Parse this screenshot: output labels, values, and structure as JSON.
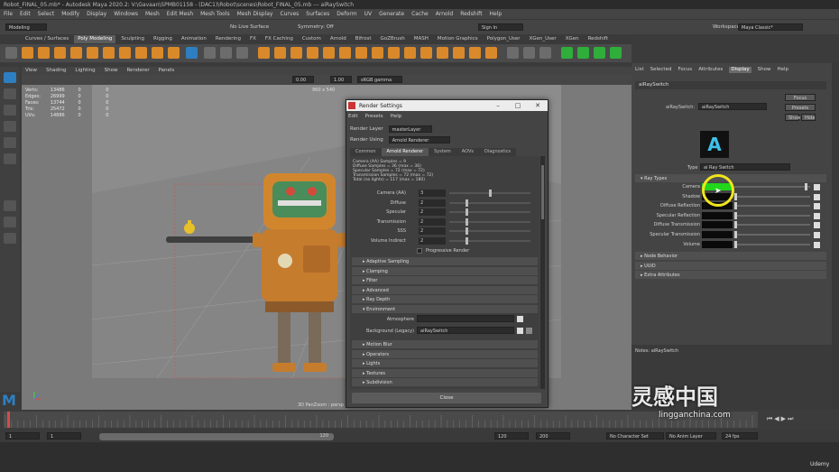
{
  "window": {
    "title": "Robot_FINAL_05.mb* - Autodesk Maya 2020.2: V:\\Gavaan\\SPMB01158 - (DAC1)\\Robot\\scenes\\Robot_FINAL_05.mb --- aiRaySwitch"
  },
  "menubar": [
    "File",
    "Edit",
    "Select",
    "Modify",
    "Display",
    "Windows",
    "Mesh",
    "Edit Mesh",
    "Mesh Tools",
    "Mesh Display",
    "Curves",
    "Surfaces",
    "Deform",
    "UV",
    "Generate",
    "Cache",
    "Arnold",
    "Redshift",
    "Help"
  ],
  "statusline": {
    "mode": "Modeling",
    "live_surface": "No Live Surface",
    "symmetry": "Symmetry: Off",
    "sign_in": "Sign In",
    "workspace_label": "Workspace:",
    "workspace": "Maya Classic*"
  },
  "shelf_tabs": [
    {
      "label": "Curves / Surfaces",
      "active": false
    },
    {
      "label": "Poly Modeling",
      "active": true
    },
    {
      "label": "Sculpting",
      "active": false
    },
    {
      "label": "Rigging",
      "active": false
    },
    {
      "label": "Animation",
      "active": false
    },
    {
      "label": "Rendering",
      "active": false
    },
    {
      "label": "FX",
      "active": false
    },
    {
      "label": "FX Caching",
      "active": false
    },
    {
      "label": "Custom",
      "active": false
    },
    {
      "label": "Arnold",
      "active": false
    },
    {
      "label": "Bifrost",
      "active": false
    },
    {
      "label": "GoZBrush",
      "active": false
    },
    {
      "label": "MASH",
      "active": false
    },
    {
      "label": "Motion Graphics",
      "active": false
    },
    {
      "label": "Polygon_User",
      "active": false
    },
    {
      "label": "XGen_User",
      "active": false
    },
    {
      "label": "XGen",
      "active": false
    },
    {
      "label": "Redshift",
      "active": false
    }
  ],
  "viewport": {
    "menu": [
      "View",
      "Shading",
      "Lighting",
      "Show",
      "Renderer",
      "Panels"
    ],
    "hud": [
      {
        "name": "Verts:",
        "a": "13486",
        "b": "0",
        "c": "0"
      },
      {
        "name": "Edges:",
        "a": "26999",
        "b": "0",
        "c": "0"
      },
      {
        "name": "Faces:",
        "a": "13744",
        "b": "0",
        "c": "0"
      },
      {
        "name": "Tris:",
        "a": "25472",
        "b": "0",
        "c": "0"
      },
      {
        "name": "UVs:",
        "a": "14886",
        "b": "0",
        "c": "0"
      }
    ],
    "resolution": "960 x 540",
    "camera": "3D PanZoom : persp",
    "exposure": "0.00",
    "gamma": "1.00",
    "colorspace": "sRGB gamma"
  },
  "render_settings": {
    "title": "Render Settings",
    "menu": [
      "Edit",
      "Presets",
      "Help"
    ],
    "render_layer_label": "Render Layer",
    "render_layer": "masterLayer",
    "render_using_label": "Render Using",
    "render_using": "Arnold Renderer",
    "tabs": [
      {
        "label": "Common",
        "active": false
      },
      {
        "label": "Arnold Renderer",
        "active": true
      },
      {
        "label": "System",
        "active": false
      },
      {
        "label": "AOVs",
        "active": false
      },
      {
        "label": "Diagnostics",
        "active": false
      }
    ],
    "stats": [
      "Camera (AA) Samples = 9",
      "Diffuse Samples = 36 (max = 36)",
      "Specular Samples = 72 (max = 72)",
      "Transmission Samples = 72 (max = 72)",
      "Total (no lights) = 117 (max = 180)"
    ],
    "samples": [
      {
        "label": "Camera (AA)",
        "value": "3",
        "level": 0.5
      },
      {
        "label": "Diffuse",
        "value": "2",
        "level": 0.2
      },
      {
        "label": "Specular",
        "value": "2",
        "level": 0.2
      },
      {
        "label": "Transmission",
        "value": "2",
        "level": 0.2
      },
      {
        "label": "SSS",
        "value": "2",
        "level": 0.2
      },
      {
        "label": "Volume Indirect",
        "value": "2",
        "level": 0.2
      }
    ],
    "progressive": "Progressive Render",
    "sections": [
      "Adaptive Sampling",
      "Clamping",
      "Filter",
      "Advanced",
      "Ray Depth"
    ],
    "environment": {
      "label": "Environment",
      "atmosphere_label": "Atmosphere",
      "background_label": "Background (Legacy)",
      "background": "aiRaySwitch"
    },
    "sections_after": [
      "Motion Blur",
      "Operators",
      "Lights",
      "Textures",
      "Subdivision"
    ],
    "close": "Close"
  },
  "attribute_editor": {
    "menu": [
      {
        "label": "List",
        "active": false
      },
      {
        "label": "Selected",
        "active": false
      },
      {
        "label": "Focus",
        "active": false
      },
      {
        "label": "Attributes",
        "active": false
      },
      {
        "label": "Display",
        "active": true
      },
      {
        "label": "Show",
        "active": false
      },
      {
        "label": "Help",
        "active": false
      }
    ],
    "tab": "aiRaySwitch",
    "node_label": "aiRaySwitch:",
    "node_value": "aiRaySwitch",
    "buttons": {
      "focus": "Focus",
      "presets": "Presets",
      "show": "Show",
      "hide": "Hide"
    },
    "type_label": "Type",
    "type_value": "ai Ray Switch",
    "ray_types_label": "Ray Types",
    "ray_types": [
      {
        "label": "Camera",
        "color": "#22d61c"
      },
      {
        "label": "Shadow",
        "color": "#0a0a0a"
      },
      {
        "label": "Diffuse Reflection",
        "color": "#0a0a0a"
      },
      {
        "label": "Specular Reflection",
        "color": "#0a0a0a"
      },
      {
        "label": "Diffuse Transmission",
        "color": "#0a0a0a"
      },
      {
        "label": "Specular Transmission",
        "color": "#0a0a0a"
      },
      {
        "label": "Volume",
        "color": "#0a0a0a"
      }
    ],
    "collapsed": [
      "Node Behavior",
      "UUID",
      "Extra Attributes"
    ],
    "notes": "Notes:  aiRaySwitch"
  },
  "timeline": {
    "start": "1",
    "start2": "1",
    "current": "120",
    "end": "120",
    "end2": "200",
    "character_set": "No Character Set",
    "anim_layer": "No Anim Layer",
    "fps": "24 fps"
  },
  "watermark": "灵感中国",
  "watermark_url": "lingganchina.com",
  "udemy": "Udemy",
  "colors": {
    "accent_blue": "#2d7fc1",
    "ray_camera_green": "#22d61c",
    "cursor_yellow": "#f2e51b"
  }
}
